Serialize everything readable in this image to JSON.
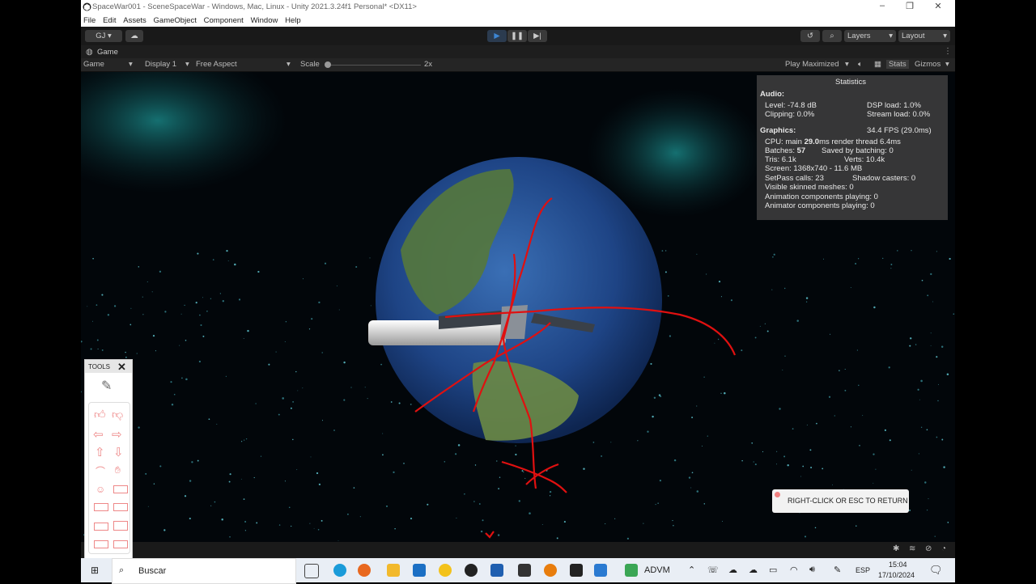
{
  "window": {
    "title": "SpaceWar001 - SceneSpaceWar - Windows, Mac, Linux - Unity 2021.3.24f1 Personal* <DX11>",
    "controls": [
      "–",
      "❐",
      "✕"
    ]
  },
  "menu": [
    "File",
    "Edit",
    "Assets",
    "GameObject",
    "Component",
    "Window",
    "Help"
  ],
  "toolbar": {
    "account": "GJ ▾",
    "layers": "Layers",
    "layout": "Layout"
  },
  "game_tab": {
    "label": "Game"
  },
  "game_bar": {
    "view": "Game",
    "display": "Display 1",
    "aspect": "Free Aspect",
    "scale_label": "Scale",
    "scale_value": "2x",
    "play_mode": "Play Maximized",
    "stats": "Stats",
    "gizmos": "Gizmos"
  },
  "stats": {
    "title": "Statistics",
    "audio_header": "Audio:",
    "level": "Level: -74.8 dB",
    "dsp": "DSP load: 1.0%",
    "clipping": "Clipping: 0.0%",
    "stream": "Stream load: 0.0%",
    "graphics_header": "Graphics:",
    "fps": "34.4 FPS (29.0ms)",
    "cpu_prefix": "CPU: main ",
    "cpu_main": "29.0",
    "cpu_suffix": "ms  render thread 6.4ms",
    "batches_prefix": "Batches: ",
    "batches": "57",
    "saved_batching": "Saved by batching: 0",
    "tris": "Tris: 6.1k",
    "verts": "Verts: 10.4k",
    "screen": "Screen: 1368x740 - 11.6 MB",
    "setpass": "SetPass calls: 23",
    "shadow": "Shadow casters: 0",
    "skinned": "Visible skinned meshes: 0",
    "anim": "Animation components playing: 0",
    "animator": "Animator components playing: 0"
  },
  "tools_panel": {
    "title": "TOOLS",
    "close": "✕"
  },
  "overlay": {
    "right_click": "RIGHT-CLICK OR ESC TO RETURN"
  },
  "taskbar": {
    "search": "Buscar",
    "advm": "ADVM",
    "lang": "ESP",
    "time": "15:04",
    "date": "17/10/2024"
  },
  "colors": {
    "accent": "#3d86d4",
    "annotation": "#e01010",
    "stats_bg": "#3c3c3c"
  }
}
